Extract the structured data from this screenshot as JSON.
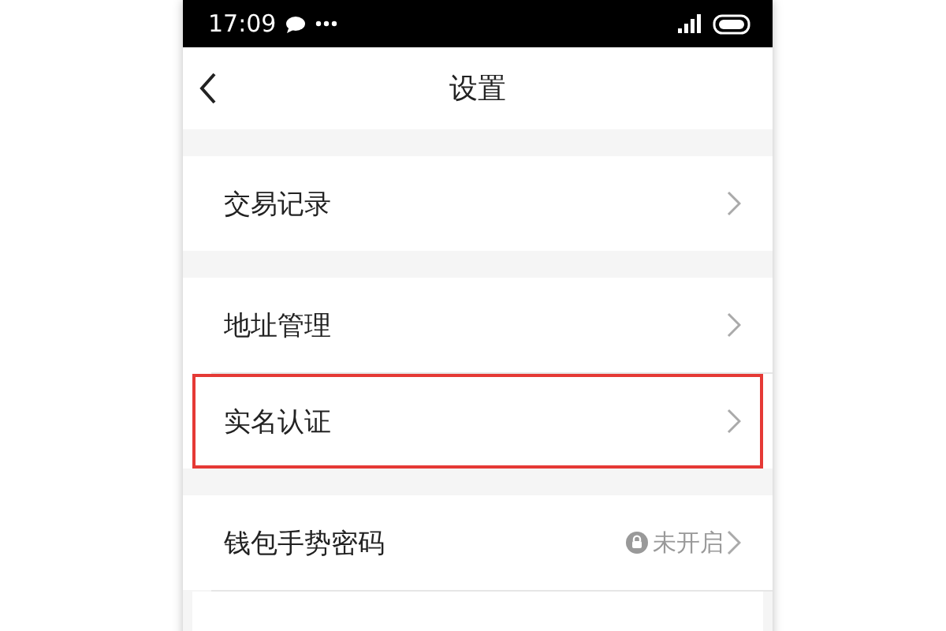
{
  "status_bar": {
    "time": "17:09"
  },
  "nav": {
    "title": "设置"
  },
  "groups": [
    {
      "items": [
        {
          "label": "交易记录",
          "highlighted": false
        }
      ]
    },
    {
      "items": [
        {
          "label": "地址管理",
          "highlighted": false
        },
        {
          "label": "实名认证",
          "highlighted": true
        }
      ]
    },
    {
      "items": [
        {
          "label": "钱包手势密码",
          "highlighted": false,
          "status": "未开启"
        }
      ]
    }
  ]
}
